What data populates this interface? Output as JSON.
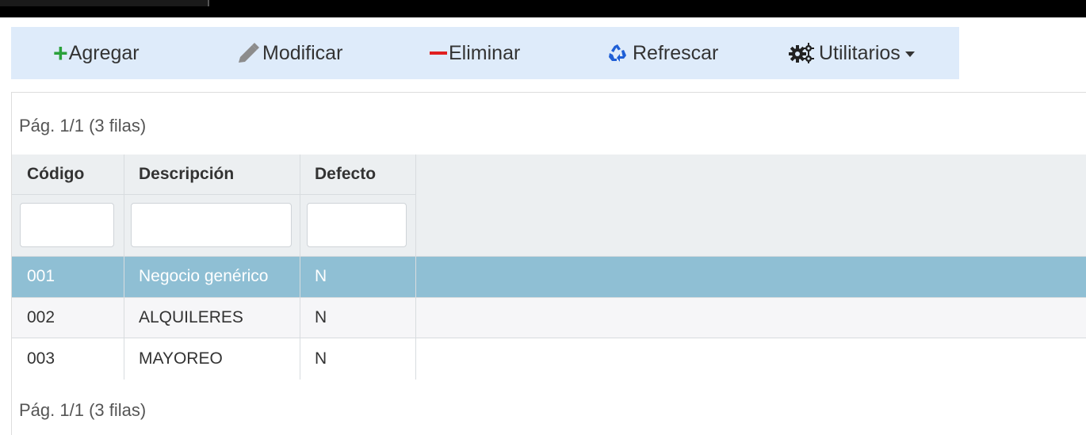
{
  "toolbar": {
    "add_label": "Agregar",
    "modify_label": "Modificar",
    "delete_label": "Eliminar",
    "refresh_label": "Refrescar",
    "utilities_label": "Utilitarios"
  },
  "pager": {
    "top": "Pág. 1/1 (3 filas)",
    "bottom": "Pág. 1/1 (3 filas)"
  },
  "table": {
    "columns": [
      "Código",
      "Descripción",
      "Defecto"
    ],
    "rows": [
      [
        "001",
        "Negocio genérico",
        "N"
      ],
      [
        "002",
        "ALQUILERES",
        "N"
      ],
      [
        "003",
        "MAYOREO",
        "N"
      ]
    ],
    "selected_row": 0
  },
  "colors": {
    "toolbar_bg": "#deebfa",
    "add_icon": "#2aa13b",
    "delete_icon": "#e02020",
    "refresh_icon": "#1f5fd6",
    "selected_row_bg": "#8fbfd4",
    "header_bg": "#eceff1"
  },
  "icons": {
    "add": "plus-icon",
    "modify": "pencil-icon",
    "delete": "minus-icon",
    "refresh": "recycle-icon",
    "utilities": "gears-icon"
  }
}
